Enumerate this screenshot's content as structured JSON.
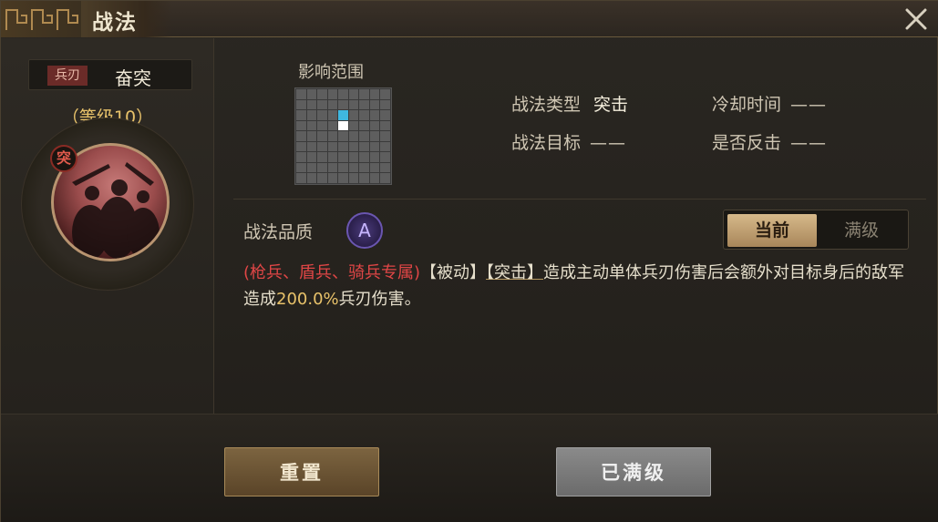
{
  "window": {
    "title": "战法"
  },
  "skill": {
    "type_tag": "兵刃",
    "name": "奋突",
    "level": "（等级10）",
    "badge": "突"
  },
  "range": {
    "label": "影响范围",
    "grid_size": 9,
    "target_cell": {
      "row": 2,
      "col": 4
    },
    "self_cell": {
      "row": 3,
      "col": 4
    }
  },
  "info": {
    "type_label": "战法类型",
    "type_value": "突击",
    "cooldown_label": "冷却时间",
    "cooldown_value": "——",
    "target_label": "战法目标",
    "target_value": "——",
    "counter_label": "是否反击",
    "counter_value": "——"
  },
  "quality": {
    "label": "战法品质",
    "grade": "A"
  },
  "toggle": {
    "current": "当前",
    "max": "满级",
    "selected": "current"
  },
  "description": {
    "troops": "(枪兵、盾兵、骑兵专属)",
    "passive": "【被动】",
    "assault": "【突击】",
    "text1": "造成主动单体兵刃伤害后会额外对目标身后的敌军造成",
    "percent": "200.0%",
    "text2": "兵刃伤害。"
  },
  "buttons": {
    "reset": "重置",
    "maxed": "已满级"
  },
  "colors": {
    "accent_gold": "#e8c26a",
    "exclusive_red": "#e04646",
    "range_target": "#3fb8e0"
  }
}
